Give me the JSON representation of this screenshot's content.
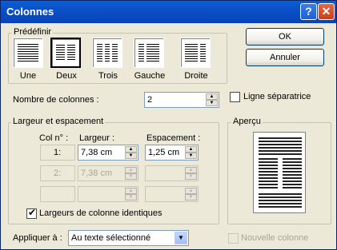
{
  "window": {
    "title": "Colonnes"
  },
  "presets": {
    "group_title": "Prédéfinir",
    "items": [
      {
        "label": "Une",
        "selected": false
      },
      {
        "label": "Deux",
        "selected": true
      },
      {
        "label": "Trois",
        "selected": false
      },
      {
        "label": "Gauche",
        "selected": false
      },
      {
        "label": "Droite",
        "selected": false
      }
    ]
  },
  "buttons": {
    "ok": "OK",
    "cancel": "Annuler"
  },
  "num_columns": {
    "label": "Nombre de colonnes :",
    "value": "2"
  },
  "separator": {
    "label": "Ligne séparatrice",
    "checked": false
  },
  "width_spacing": {
    "group_title": "Largeur et espacement",
    "headers": {
      "col": "Col n° :",
      "width": "Largeur :",
      "spacing": "Espacement :"
    },
    "rows": [
      {
        "col": "1:",
        "width": "7,38 cm",
        "spacing": "1,25 cm",
        "enabled": true
      },
      {
        "col": "2:",
        "width": "7,38 cm",
        "spacing": "",
        "enabled": false
      },
      {
        "col": "",
        "width": "",
        "spacing": "",
        "enabled": false
      }
    ],
    "equal_width": {
      "label": "Largeurs de colonne identiques",
      "checked": true
    }
  },
  "preview": {
    "title": "Aperçu"
  },
  "apply_to": {
    "label": "Appliquer à :",
    "value": "Au texte sélectionné"
  },
  "new_column": {
    "label": "Nouvelle colonne",
    "checked": false
  }
}
